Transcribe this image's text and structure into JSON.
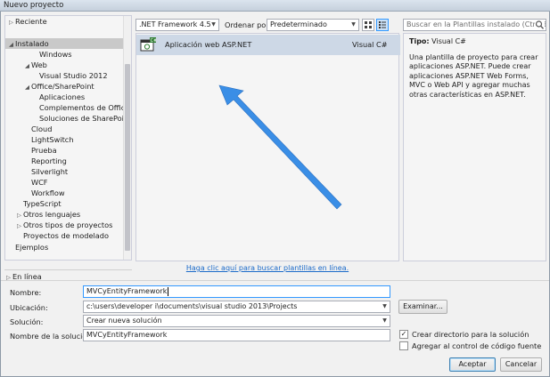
{
  "window": {
    "title": "Nuevo proyecto"
  },
  "tree": {
    "items": [
      {
        "label": "Reciente",
        "arrow": "▷",
        "indent": 0
      },
      {
        "label": "Instalado",
        "arrow": "◢",
        "indent": 0,
        "selected": true
      },
      {
        "label": "Windows",
        "arrow": "",
        "indent": 3
      },
      {
        "label": "Web",
        "arrow": "◢",
        "indent": 2
      },
      {
        "label": "Visual Studio 2012",
        "arrow": "",
        "indent": 3
      },
      {
        "label": "Office/SharePoint",
        "arrow": "◢",
        "indent": 2
      },
      {
        "label": "Aplicaciones",
        "arrow": "",
        "indent": 3
      },
      {
        "label": "Complementos de Office",
        "arrow": "",
        "indent": 3
      },
      {
        "label": "Soluciones de SharePoint",
        "arrow": "",
        "indent": 3
      },
      {
        "label": "Cloud",
        "arrow": "",
        "indent": 2
      },
      {
        "label": "LightSwitch",
        "arrow": "",
        "indent": 2
      },
      {
        "label": "Prueba",
        "arrow": "",
        "indent": 2
      },
      {
        "label": "Reporting",
        "arrow": "",
        "indent": 2
      },
      {
        "label": "Silverlight",
        "arrow": "",
        "indent": 2
      },
      {
        "label": "WCF",
        "arrow": "",
        "indent": 2
      },
      {
        "label": "Workflow",
        "arrow": "",
        "indent": 2
      },
      {
        "label": "TypeScript",
        "arrow": "",
        "indent": 1
      },
      {
        "label": "Otros lenguajes",
        "arrow": "▷",
        "indent": 1
      },
      {
        "label": "Otros tipos de proyectos",
        "arrow": "▷",
        "indent": 1
      },
      {
        "label": "Proyectos de modelado",
        "arrow": "",
        "indent": 1
      },
      {
        "label": "Ejemplos",
        "arrow": "",
        "indent": 0
      }
    ],
    "online": {
      "label": "En línea",
      "arrow": "▷"
    }
  },
  "toolbar": {
    "framework": ".NET Framework 4.5",
    "sort_label": "Ordenar por:",
    "sort_value": "Predeterminado",
    "search_placeholder": "Buscar en la Plantillas instalado (Ctrl+E)"
  },
  "templates": [
    {
      "name": "Aplicación web ASP.NET",
      "language": "Visual C#",
      "badge": "C#"
    }
  ],
  "details": {
    "type_label": "Tipo:",
    "type_value": "Visual C#",
    "description": "Una plantilla de proyecto para crear aplicaciones ASP.NET. Puede crear aplicaciones ASP.NET Web Forms, MVC o Web API y agregar muchas otras características en ASP.NET."
  },
  "online_link": "Haga clic aquí para buscar plantillas en línea.",
  "form": {
    "name_label": "Nombre:",
    "name_value": "MVCyEntityFramework",
    "location_label": "Ubicación:",
    "location_value": "c:\\users\\developer i\\documents\\visual studio 2013\\Projects",
    "browse_label": "Examinar...",
    "solution_label": "Solución:",
    "solution_value": "Crear nueva solución",
    "solution_name_label": "Nombre de la solución:",
    "solution_name_value": "MVCyEntityFramework",
    "create_dir_label": "Crear directorio para la solución",
    "create_dir_checked": true,
    "source_control_label": "Agregar al control de código fuente",
    "source_control_checked": false
  },
  "buttons": {
    "ok": "Aceptar",
    "cancel": "Cancelar"
  },
  "colors": {
    "selection": "#cdd8e6",
    "link": "#1b6ac9",
    "arrow": "#3a8ee6"
  }
}
